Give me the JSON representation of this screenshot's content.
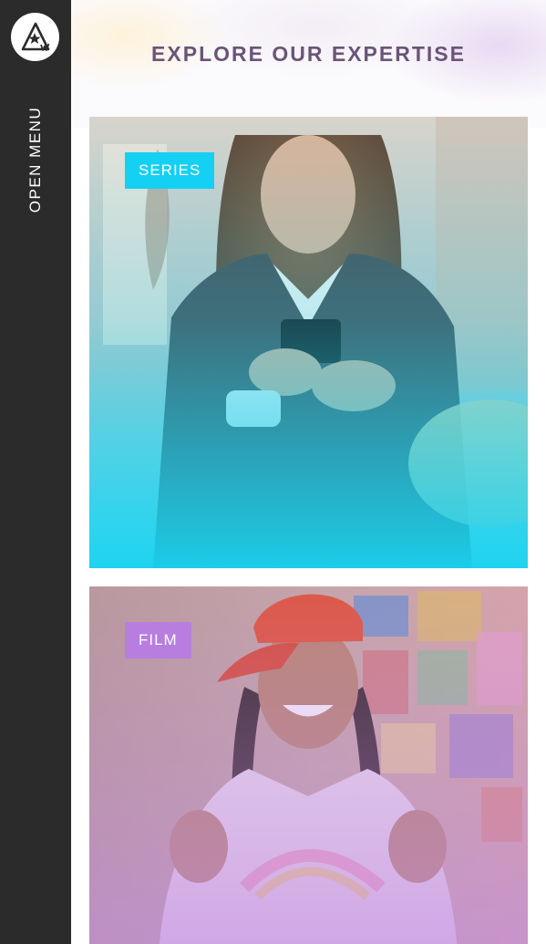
{
  "sidebar": {
    "logo_icon": "aw-logo-icon",
    "menu_label": "OPEN MENU"
  },
  "main": {
    "title": "EXPLORE OUR EXPERTISE",
    "cards": [
      {
        "label": "SERIES",
        "accent": "#19d3f0",
        "badge_color": "#14d0f2"
      },
      {
        "label": "FILM",
        "accent": "#c08ae0",
        "badge_color": "#b77ee0"
      }
    ]
  }
}
